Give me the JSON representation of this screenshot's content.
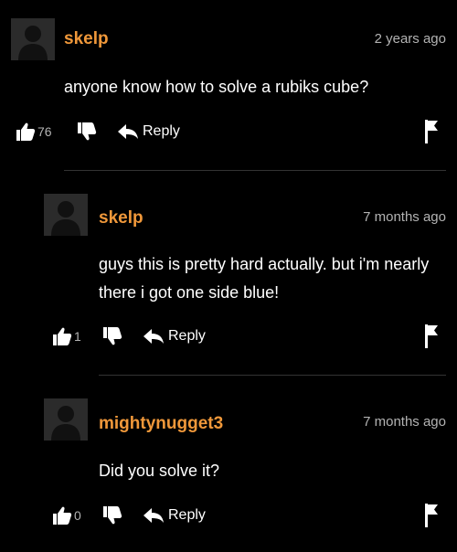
{
  "comments": [
    {
      "username": "skelp",
      "time": "2 years ago",
      "text": "anyone know how to solve a rubiks cube?",
      "likes": "76",
      "reply_label": "Reply"
    },
    {
      "username": "skelp",
      "time": "7 months ago",
      "text": "guys this is pretty hard actually. but i'm nearly there i got one side blue!",
      "likes": "1",
      "reply_label": "Reply"
    },
    {
      "username": "mightynugget3",
      "time": "7 months ago",
      "text": "Did you solve it?",
      "likes": "0",
      "reply_label": "Reply"
    }
  ],
  "icons": {
    "like": "thumbs-up-icon",
    "dislike": "thumbs-down-icon",
    "reply": "reply-arrow-icon",
    "flag": "flag-icon"
  },
  "colors": {
    "background": "#000000",
    "username": "#f0983a",
    "meta": "#b3b3b3",
    "avatar": "#2b2b2b"
  }
}
